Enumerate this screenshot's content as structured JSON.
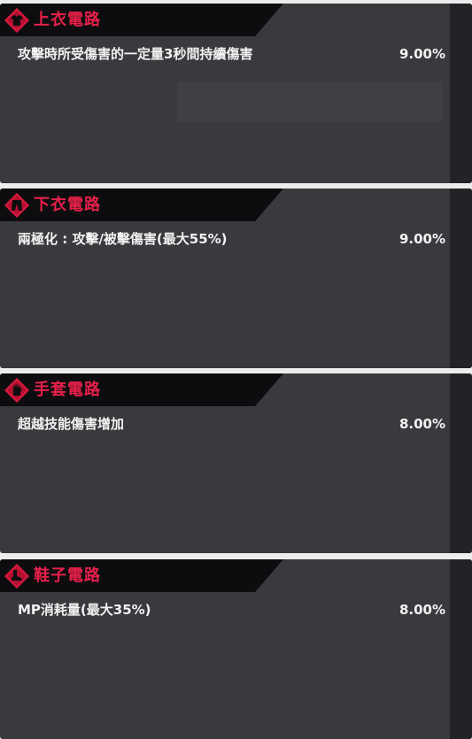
{
  "circuits": [
    {
      "title": "上衣電路",
      "icon": "shirt-icon",
      "stat": "攻擊時所受傷害的一定量3秒間持續傷害",
      "value": "9.00%"
    },
    {
      "title": "下衣電路",
      "icon": "pants-icon",
      "stat": "兩極化 : 攻擊/被擊傷害(最大55%)",
      "value": "9.00%"
    },
    {
      "title": "手套電路",
      "icon": "glove-icon",
      "stat": "超越技能傷害增加",
      "value": "8.00%"
    },
    {
      "title": "鞋子電路",
      "icon": "shoe-icon",
      "stat": "MP消耗量(最大35%)",
      "value": "8.00%"
    }
  ],
  "colors": {
    "accent": "#e8204a",
    "card_bg": "#393a3d",
    "header_bg": "#0d0d0f"
  }
}
